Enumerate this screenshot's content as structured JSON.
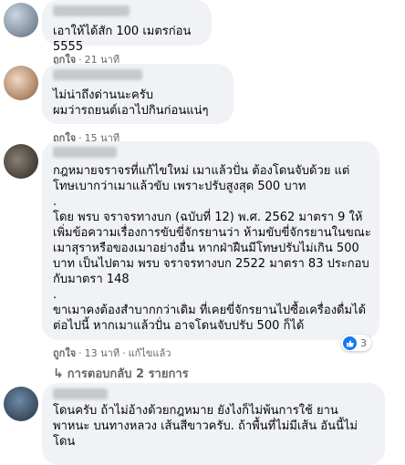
{
  "comments": [
    {
      "text": "เอาให้ได้สัก 100 เมตรก่อน 5555",
      "like_label": "ถูกใจ",
      "time": "21 นาที"
    },
    {
      "text": "ไม่น่าถึงด่านนะครับ\nผมว่ารถยนต์เอาไปกินก่อนแน่ๆ",
      "like_label": "ถูกใจ",
      "time": "15 นาที"
    },
    {
      "text": "กฎหมายจราจรที่แก้ไขใหม่ เมาแล้วปั่น ต้องโดนจับด้วย แต่\nโทษเบากว่าเมาแล้วขับ เพราะปรับสูงสุด 500 บาท\n.\nโดย พรบ จราจรทางบก (ฉบับที่ 12) พ.ศ. 2562 มาตรา 9 ให้\nเพิ่มข้อความเรื่องการขับขี่จักรยานว่า ห้ามขับขี่จักรยานในขณะ\nเมาสุราหรือของเมาอย่างอื่น หากฝ่าฝืนมีโทษปรับไม่เกิน 500\nบาท เป็นไปตาม พรบ จราจรทางบก 2522 มาตรา 83 ประกอบ\nกับมาตรา 148\n.\nขาเมาคงต้องสำบากกว่าเดิม ที่เคยขี่จักรยานไปซื้อเครื่องดื่มได้\nต่อไปนี้ หากเมาแล้วปั่น อาจโดนจับปรับ 500 ก็ได้",
      "like_label": "ถูกใจ",
      "time": "13 นาที",
      "edited_label": "แก้ไขแล้ว",
      "reaction_count": "3",
      "replies_label": "การตอบกลับ 2 รายการ"
    },
    {
      "text": "โดนครับ ถ้าไม่อ้างด้วยกฎหมาย ยังไงก็ไม่พ้นการใช้ ยาน\nพาหนะ บนทางหลวง เส้นสีขาวครับ. ถ้าพื้นที่ไม่มีเส้น อันนี้ไม่\nโดน"
    }
  ],
  "colors": {
    "bubble": "#f0f2f5",
    "meta": "#65676b",
    "like_blue": "#1877f2"
  }
}
